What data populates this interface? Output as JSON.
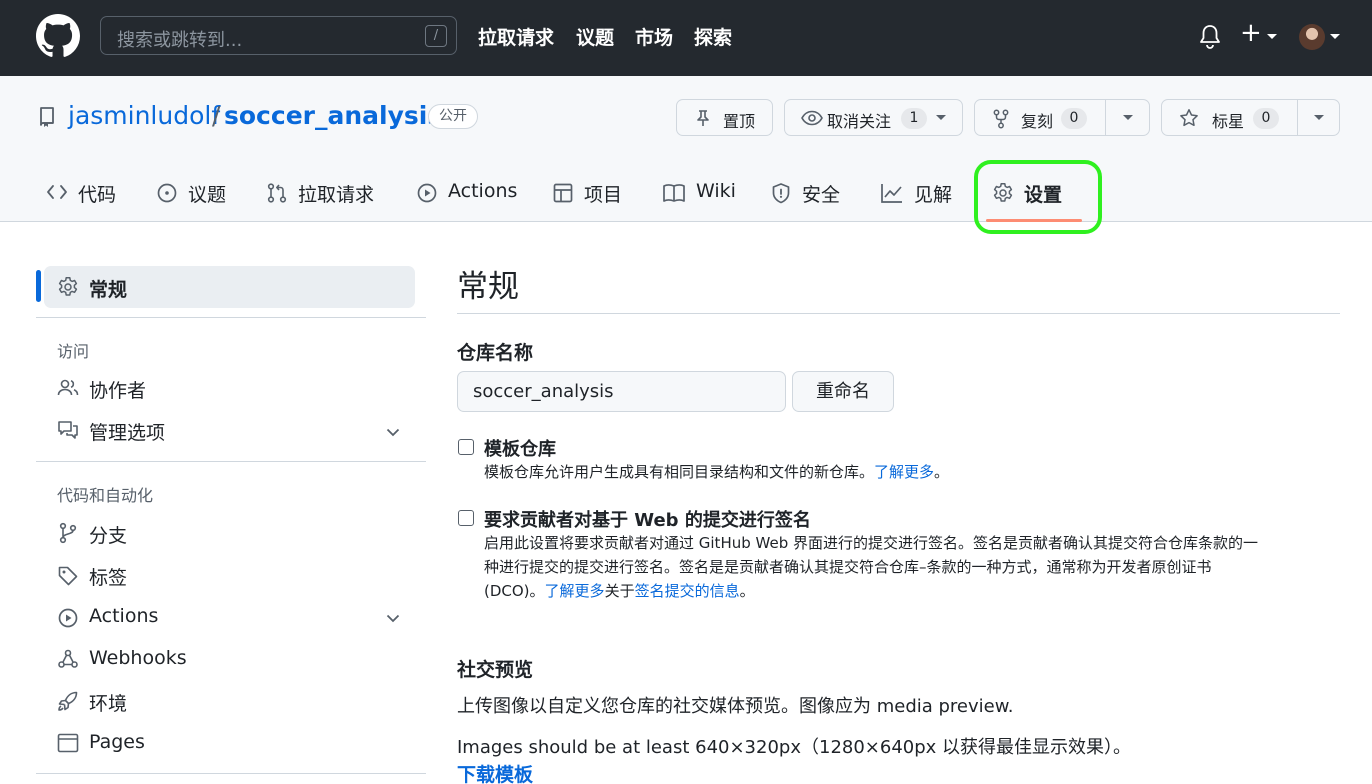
{
  "header": {
    "search_placeholder": "搜索或跳转到...",
    "search_shortcut": "/",
    "nav": [
      "拉取请求",
      "议题",
      "市场",
      "探索"
    ]
  },
  "repo": {
    "owner": "jasminludolf",
    "separator": "/",
    "name": "soccer_analysis",
    "visibility": "公开",
    "actions": {
      "pin_label": "置顶",
      "watch_label": "取消关注",
      "watch_count": "1",
      "fork_label": "复刻",
      "fork_count": "0",
      "star_label": "标星",
      "star_count": "0"
    },
    "tabs": [
      {
        "label": "代码",
        "icon": "code-icon"
      },
      {
        "label": "议题",
        "icon": "issue-icon"
      },
      {
        "label": "拉取请求",
        "icon": "pull-request-icon"
      },
      {
        "label": "Actions",
        "icon": "play-icon"
      },
      {
        "label": "项目",
        "icon": "table-icon"
      },
      {
        "label": "Wiki",
        "icon": "book-icon"
      },
      {
        "label": "安全",
        "icon": "shield-icon"
      },
      {
        "label": "见解",
        "icon": "graph-icon"
      },
      {
        "label": "设置",
        "icon": "gear-icon"
      }
    ],
    "active_tab": "设置"
  },
  "sidebar": {
    "active_item": "常规",
    "groups": [
      {
        "title": "访问",
        "items": [
          "协作者",
          "管理选项"
        ]
      },
      {
        "title": "代码和自动化",
        "items": [
          "分支",
          "标签",
          "Actions",
          "Webhooks",
          "环境",
          "Pages"
        ]
      }
    ]
  },
  "main": {
    "title": "常规",
    "repo_name_label": "仓库名称",
    "repo_name_value": "soccer_analysis",
    "rename_button": "重命名",
    "template": {
      "title": "模板仓库",
      "desc": "模板仓库允许用户生成具有相同目录结构和文件的新仓库。",
      "link": "了解更多",
      "end": "。"
    },
    "signoff": {
      "title": "要求贡献者对基于 Web 的提交进行签名",
      "line1": "启用此设置将要求贡献者对通过 GitHub Web 界面进行的提交进行签名。签名是贡献者确认其提交符合仓库条款的一",
      "line2": "种进行提交的提交进行签名。签名是是贡献者确认其提交符合仓库–条款的一种方式，通常称为开发者原创证书",
      "line3_start": "(DCO)。",
      "link1": "了解更多",
      "mid": "关于",
      "link2": "签名提交的信息",
      "end": "。"
    },
    "social": {
      "title": "社交预览",
      "desc": "上传图像以自定义您仓库的社交媒体预览。图像应为 media preview.",
      "size_note": "Images should be at least 640×320px（1280×640px 以获得最佳显示效果）。",
      "download_link": "下载模板"
    }
  },
  "colors": {
    "header_bg": "#24292f",
    "link": "#0969da",
    "active_underline": "#fd8c73",
    "highlight": "#2ff01f"
  }
}
